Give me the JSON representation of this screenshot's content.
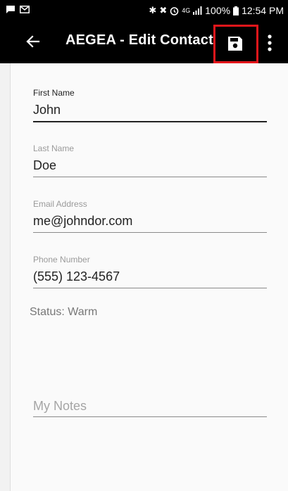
{
  "status_bar": {
    "battery": "100%",
    "time": "12:54 PM",
    "icons": [
      "message-icon",
      "email-icon",
      "bluetooth-icon",
      "mute-icon",
      "alarm-icon",
      "lte-icon",
      "signal-icon",
      "battery-icon"
    ],
    "network_label": "4G"
  },
  "app_bar": {
    "title": "AEGEA - Edit Contact",
    "back_icon": "back-arrow-icon",
    "save_icon": "save-icon",
    "more_icon": "more-vert-icon",
    "highlight_color": "#e4161b"
  },
  "form": {
    "first_name": {
      "label": "First Name",
      "value": "John"
    },
    "last_name": {
      "label": "Last Name",
      "value": "Doe"
    },
    "email": {
      "label": "Email Address",
      "value": "me@johndor.com"
    },
    "phone": {
      "label": "Phone Number",
      "value": "(555) 123-4567"
    },
    "status": "Status: Warm",
    "notes_placeholder": "My Notes"
  }
}
